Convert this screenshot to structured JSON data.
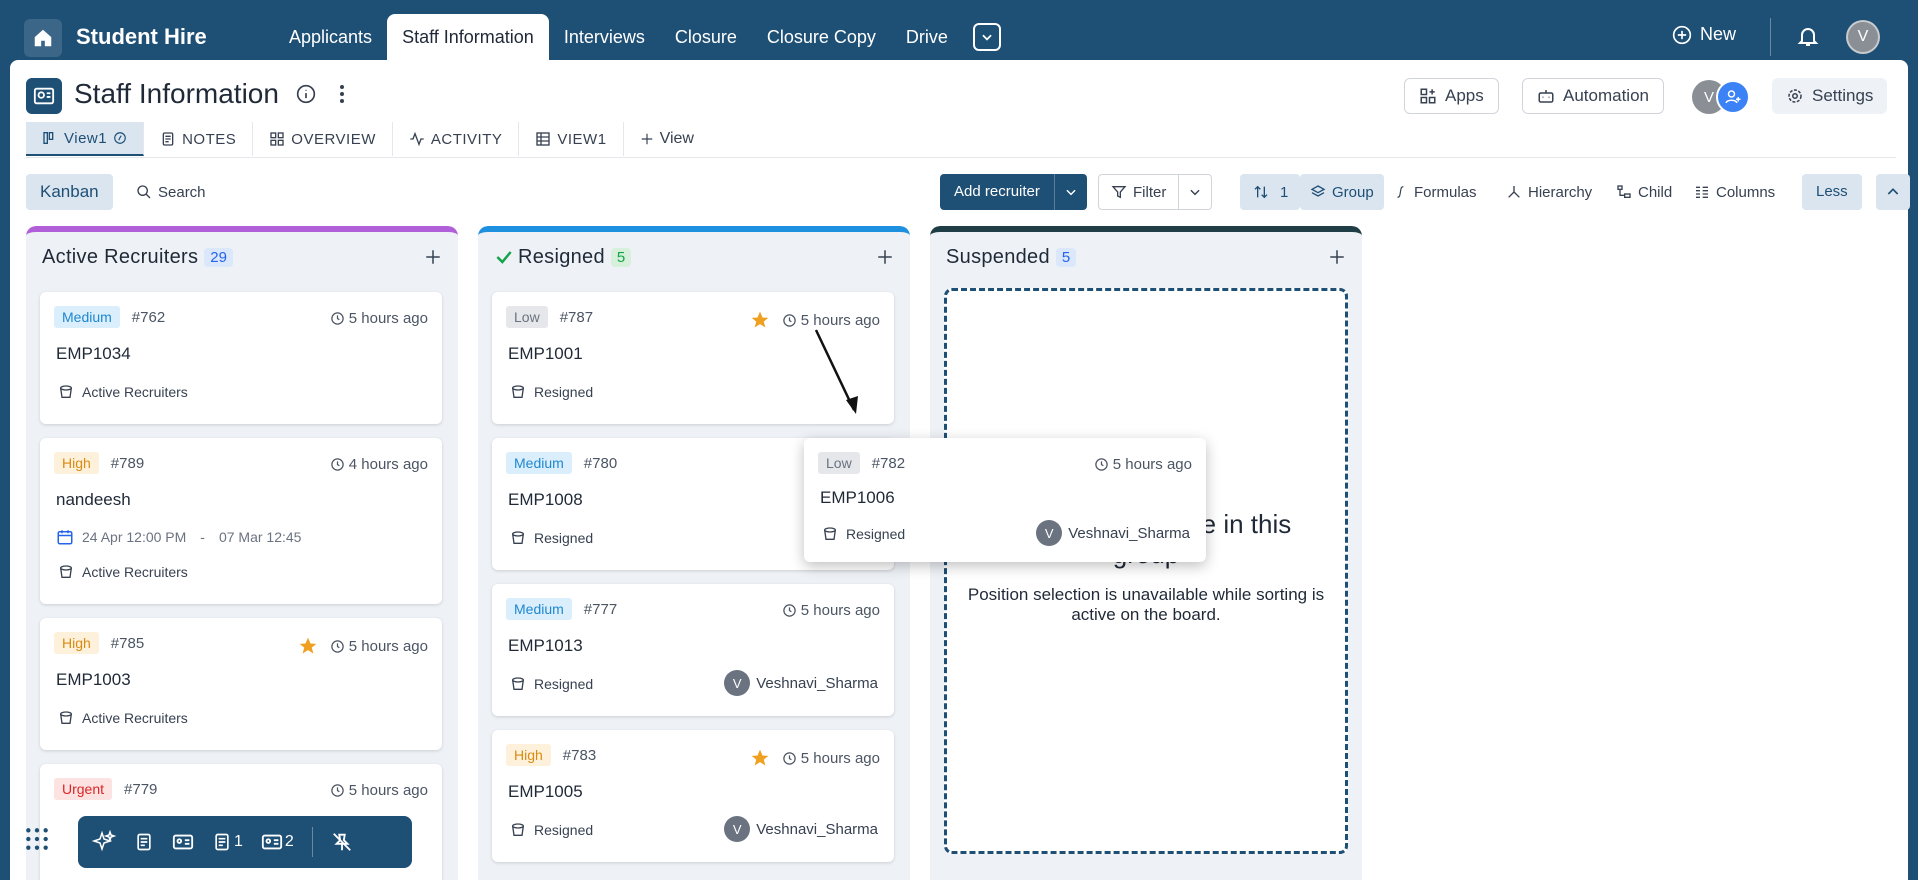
{
  "app": {
    "name": "Student Hire"
  },
  "nav": {
    "tabs": [
      "Applicants",
      "Staff Information",
      "Interviews",
      "Closure",
      "Closure Copy",
      "Drive"
    ],
    "active": "Staff Information",
    "new_label": "New",
    "avatar": "V"
  },
  "page": {
    "title": "Staff Information",
    "apps_label": "Apps",
    "automation_label": "Automation",
    "avatar": "V",
    "settings_label": "Settings"
  },
  "view_tabs": {
    "active_view": "View1",
    "notes": "NOTES",
    "overview": "OVERVIEW",
    "activity": "ACTIVITY",
    "view1": "VIEW1",
    "add_view": "View"
  },
  "toolbar": {
    "kanban": "Kanban",
    "search": "Search",
    "add_recruiter": "Add recruiter",
    "filter": "Filter",
    "sort_count": "1",
    "group": "Group",
    "formulas": "Formulas",
    "hierarchy": "Hierarchy",
    "child": "Child",
    "columns": "Columns",
    "less": "Less"
  },
  "columns": [
    {
      "title": "Active Recruiters",
      "count": "29",
      "color": "#b15fd8",
      "cards": [
        {
          "priority": "Medium",
          "num": "#762",
          "time": "5 hours ago",
          "name": "EMP1034",
          "group": "Active Recruiters"
        },
        {
          "priority": "High",
          "num": "#789",
          "time": "4 hours ago",
          "name": "nandeesh",
          "date_start": "24 Apr 12:00 PM",
          "date_sep": "-",
          "date_end": "07 Mar 12:45",
          "group": "Active Recruiters"
        },
        {
          "priority": "High",
          "num": "#785",
          "time": "5 hours ago",
          "name": "EMP1003",
          "group": "Active Recruiters",
          "starred": true
        },
        {
          "priority": "Urgent",
          "num": "#779",
          "time": "5 hours ago"
        }
      ]
    },
    {
      "title": "Resigned",
      "count": "5",
      "color": "#1e90e0",
      "cards": [
        {
          "priority": "Low",
          "num": "#787",
          "time": "5 hours ago",
          "name": "EMP1001",
          "group": "Resigned",
          "starred": true
        },
        {
          "priority": "Medium",
          "num": "#780",
          "name": "EMP1008",
          "group": "Resigned"
        },
        {
          "priority": "Medium",
          "num": "#777",
          "time": "5 hours ago",
          "name": "EMP1013",
          "group": "Resigned",
          "owner": "Veshnavi_Sharma",
          "owner_initial": "V"
        },
        {
          "priority": "High",
          "num": "#783",
          "time": "5 hours ago",
          "name": "EMP1005",
          "group": "Resigned",
          "owner": "Veshnavi_Sharma",
          "owner_initial": "V",
          "starred": true
        }
      ]
    },
    {
      "title": "Suspended",
      "count": "5",
      "color": "#1f3d44",
      "drop_title": "Drop here to move in this group",
      "drop_sub": "Position selection is unavailable while sorting is active on the board."
    }
  ],
  "drag_card": {
    "priority": "Low",
    "num": "#782",
    "time": "5 hours ago",
    "name": "EMP1006",
    "group": "Resigned",
    "owner": "Veshnavi_Sharma",
    "owner_initial": "V"
  },
  "dock": {
    "notes_count": "1",
    "cards_count": "2"
  },
  "colors": {
    "primary": "#1e4f75",
    "star": "#f0a020"
  }
}
